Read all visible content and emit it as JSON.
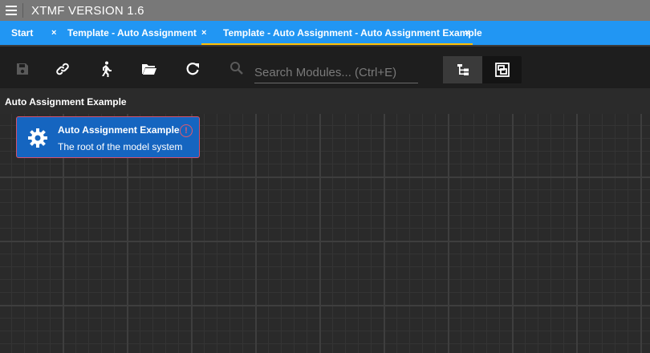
{
  "app": {
    "title": "XTMF VERSION 1.6"
  },
  "tabs": [
    {
      "label": "Start",
      "close": "×"
    },
    {
      "label": "Template - Auto Assignment",
      "close": "×"
    },
    {
      "label": "Template - Auto Assignment - Auto Assignment Example",
      "close": "×",
      "active": true
    }
  ],
  "toolbar": {
    "icons": [
      "save-icon",
      "link-icon",
      "run-icon",
      "folder-open-icon",
      "refresh-icon",
      "search-icon",
      "tree-view-icon",
      "canvas-view-icon"
    ],
    "search_placeholder": "Search Modules... (Ctrl+E)"
  },
  "breadcrumb": {
    "label": "Auto Assignment Example"
  },
  "module": {
    "name": "Auto Assignment Example",
    "description": "The root of the model system",
    "icon": "gear-icon",
    "warning_symbol": "!"
  },
  "colors": {
    "titlebar": "#787878",
    "tabbar": "#2196f3",
    "active_tab_underline": "#ffc107",
    "toolbar": "#1e1e1e",
    "canvas": "#2a2a2a",
    "module_fill": "#1565c0",
    "module_border": "#d6526e"
  }
}
